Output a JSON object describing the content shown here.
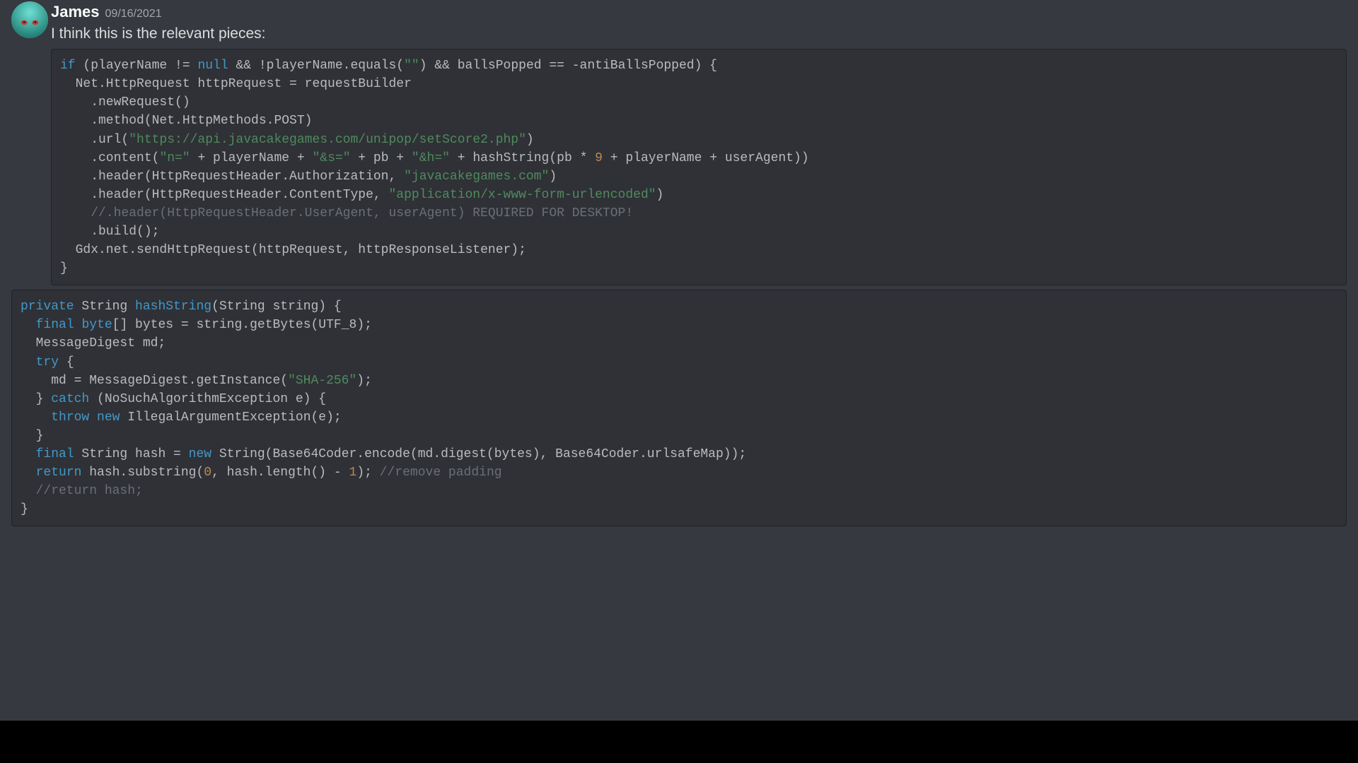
{
  "message": {
    "username": "James",
    "timestamp": "09/16/2021",
    "text": "I think this is the relevant pieces:"
  },
  "code1": {
    "l1a": "if",
    "l1b": " (playerName != ",
    "l1c": "null",
    "l1d": " && !playerName.equals(",
    "l1e": "\"\"",
    "l1f": ") && ballsPopped == -antiBallsPopped) {",
    "l2": "  Net.HttpRequest httpRequest = requestBuilder",
    "l3": "    .newRequest()",
    "l4": "    .method(Net.HttpMethods.POST)",
    "l5a": "    .url(",
    "l5b": "\"https://api.javacakegames.com/unipop/setScore2.php\"",
    "l5c": ")",
    "l6a": "    .content(",
    "l6b": "\"n=\"",
    "l6c": " + playerName + ",
    "l6d": "\"&s=\"",
    "l6e": " + pb + ",
    "l6f": "\"&h=\"",
    "l6g": " + hashString(pb * ",
    "l6h": "9",
    "l6i": " + playerName + userAgent))",
    "l7a": "    .header(HttpRequestHeader.Authorization, ",
    "l7b": "\"javacakegames.com\"",
    "l7c": ")",
    "l8a": "    .header(HttpRequestHeader.ContentType, ",
    "l8b": "\"application/x-www-form-urlencoded\"",
    "l8c": ")",
    "l9": "    //.header(HttpRequestHeader.UserAgent, userAgent) REQUIRED FOR DESKTOP!",
    "l10": "    .build();",
    "l11": "  Gdx.net.sendHttpRequest(httpRequest, httpResponseListener);",
    "l12": "}"
  },
  "code2": {
    "l1a": "private",
    "l1b": " String ",
    "l1c": "hashString",
    "l1d": "(String string) {",
    "l2a": "  ",
    "l2b": "final",
    "l2c": " ",
    "l2d": "byte",
    "l2e": "[] bytes = string.getBytes(UTF_8);",
    "l3": "  MessageDigest md;",
    "l4a": "  ",
    "l4b": "try",
    "l4c": " {",
    "l5a": "    md = MessageDigest.getInstance(",
    "l5b": "\"SHA-256\"",
    "l5c": ");",
    "l6a": "  } ",
    "l6b": "catch",
    "l6c": " (NoSuchAlgorithmException e) {",
    "l7a": "    ",
    "l7b": "throw",
    "l7c": " ",
    "l7d": "new",
    "l7e": " IllegalArgumentException(e);",
    "l8": "  }",
    "l9a": "  ",
    "l9b": "final",
    "l9c": " String hash = ",
    "l9d": "new",
    "l9e": " String(Base64Coder.encode(md.digest(bytes), Base64Coder.urlsafeMap));",
    "l10a": "  ",
    "l10b": "return",
    "l10c": " hash.substring(",
    "l10d": "0",
    "l10e": ", hash.length() - ",
    "l10f": "1",
    "l10g": "); ",
    "l10h": "//remove padding",
    "l11": "  //return hash;",
    "l12": "}"
  }
}
